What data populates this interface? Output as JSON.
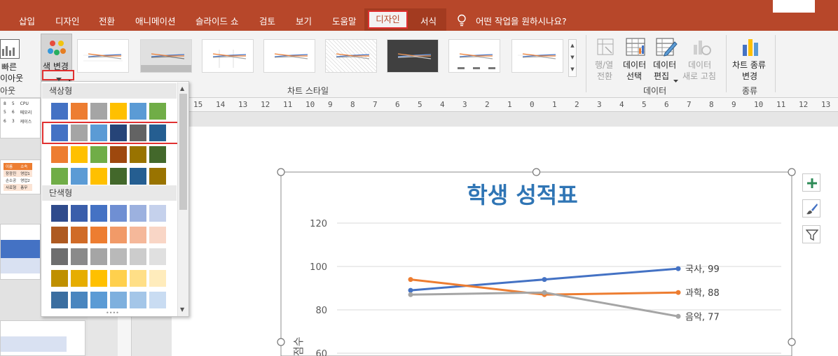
{
  "tabs": [
    "삽입",
    "디자인",
    "전환",
    "애니메이션",
    "슬라이드 쇼",
    "검토",
    "보기",
    "도움말"
  ],
  "context_tabs": {
    "active": "디자인",
    "other": "서식"
  },
  "tell_me": "어떤 작업을 원하시나요?",
  "ribbon": {
    "quick_layout": {
      "line1": "빠른",
      "line2": "이아웃",
      "group": "아웃"
    },
    "change_colors": "색 변경",
    "chart_styles_group": "차트 스타일",
    "data_group": "데이터",
    "switch_row_col": {
      "line1": "행/열",
      "line2": "전환"
    },
    "select_data": {
      "line1": "데이터",
      "line2": "선택"
    },
    "edit_data": {
      "line1": "데이터",
      "line2": "편집"
    },
    "refresh_data": {
      "line1": "데이터",
      "line2": "새로 고침"
    },
    "change_chart_type": {
      "line1": "차트 종류",
      "line2": "변경"
    },
    "type_group": "종류"
  },
  "dropdown": {
    "colorful_header": "색상형",
    "mono_header": "단색형",
    "colorful_rows": [
      [
        "#4472c4",
        "#ed7d31",
        "#a5a5a5",
        "#ffc000",
        "#5b9bd5",
        "#70ad47"
      ],
      [
        "#4472c4",
        "#a5a5a5",
        "#5b9bd5",
        "#264478",
        "#636363",
        "#255e91"
      ],
      [
        "#ed7d31",
        "#ffc000",
        "#70ad47",
        "#9e480e",
        "#997300",
        "#43682b"
      ],
      [
        "#70ad47",
        "#5b9bd5",
        "#ffc000",
        "#43682b",
        "#255e91",
        "#997300"
      ]
    ],
    "mono_rows": [
      [
        "#2f4b8c",
        "#3a5eab",
        "#4472c4",
        "#6f8fd3",
        "#9cb1df",
        "#c5d1ec"
      ],
      [
        "#ae5a21",
        "#d06b27",
        "#ed7d31",
        "#f19a68",
        "#f5b89a",
        "#f9d6c6"
      ],
      [
        "#6e6e6e",
        "#8a8a8a",
        "#a5a5a5",
        "#b9b9b9",
        "#cccccc",
        "#e0e0e0"
      ],
      [
        "#bf9000",
        "#e6ad00",
        "#ffc000",
        "#ffd04d",
        "#ffdf87",
        "#ffecbc"
      ],
      [
        "#3b6ea0",
        "#4a86bf",
        "#5b9bd5",
        "#7eb0de",
        "#a4c6e8",
        "#c9dcf2"
      ]
    ]
  },
  "ruler_numbers": [
    "15",
    "14",
    "13",
    "12",
    "11",
    "10",
    "9",
    "8",
    "7",
    "6",
    "5",
    "4",
    "3",
    "2",
    "1",
    "0",
    "1",
    "2",
    "3",
    "4",
    "5",
    "6",
    "7",
    "8",
    "9",
    "10",
    "11",
    "12",
    "13"
  ],
  "chart_data": {
    "type": "line",
    "title": "학생 성적표",
    "ylabel": "점수",
    "ylim": [
      60,
      120
    ],
    "yticks": [
      "120",
      "100",
      "80",
      "60"
    ],
    "categories": [
      "",
      "",
      ""
    ],
    "series": [
      {
        "name": "국사",
        "values": [
          89,
          94,
          99
        ],
        "color": "#4472c4",
        "label": "국사, 99"
      },
      {
        "name": "과학",
        "values": [
          94,
          87,
          88
        ],
        "color": "#ed7d31",
        "label": "과학, 88"
      },
      {
        "name": "음악",
        "values": [
          87,
          88,
          77
        ],
        "color": "#a5a5a5",
        "label": "음악, 77"
      }
    ]
  },
  "thumb_table": {
    "headers": [
      "이름",
      "소속"
    ],
    "rows": [
      [
        "장광진",
        "영업1"
      ],
      [
        "손소공",
        "영업2"
      ],
      [
        "사료형",
        "총무"
      ]
    ]
  },
  "mini_table": [
    [
      "8",
      "5",
      "CPU"
    ],
    [
      "5",
      "6",
      "메모리"
    ],
    [
      "6",
      "3",
      "케이스"
    ]
  ]
}
